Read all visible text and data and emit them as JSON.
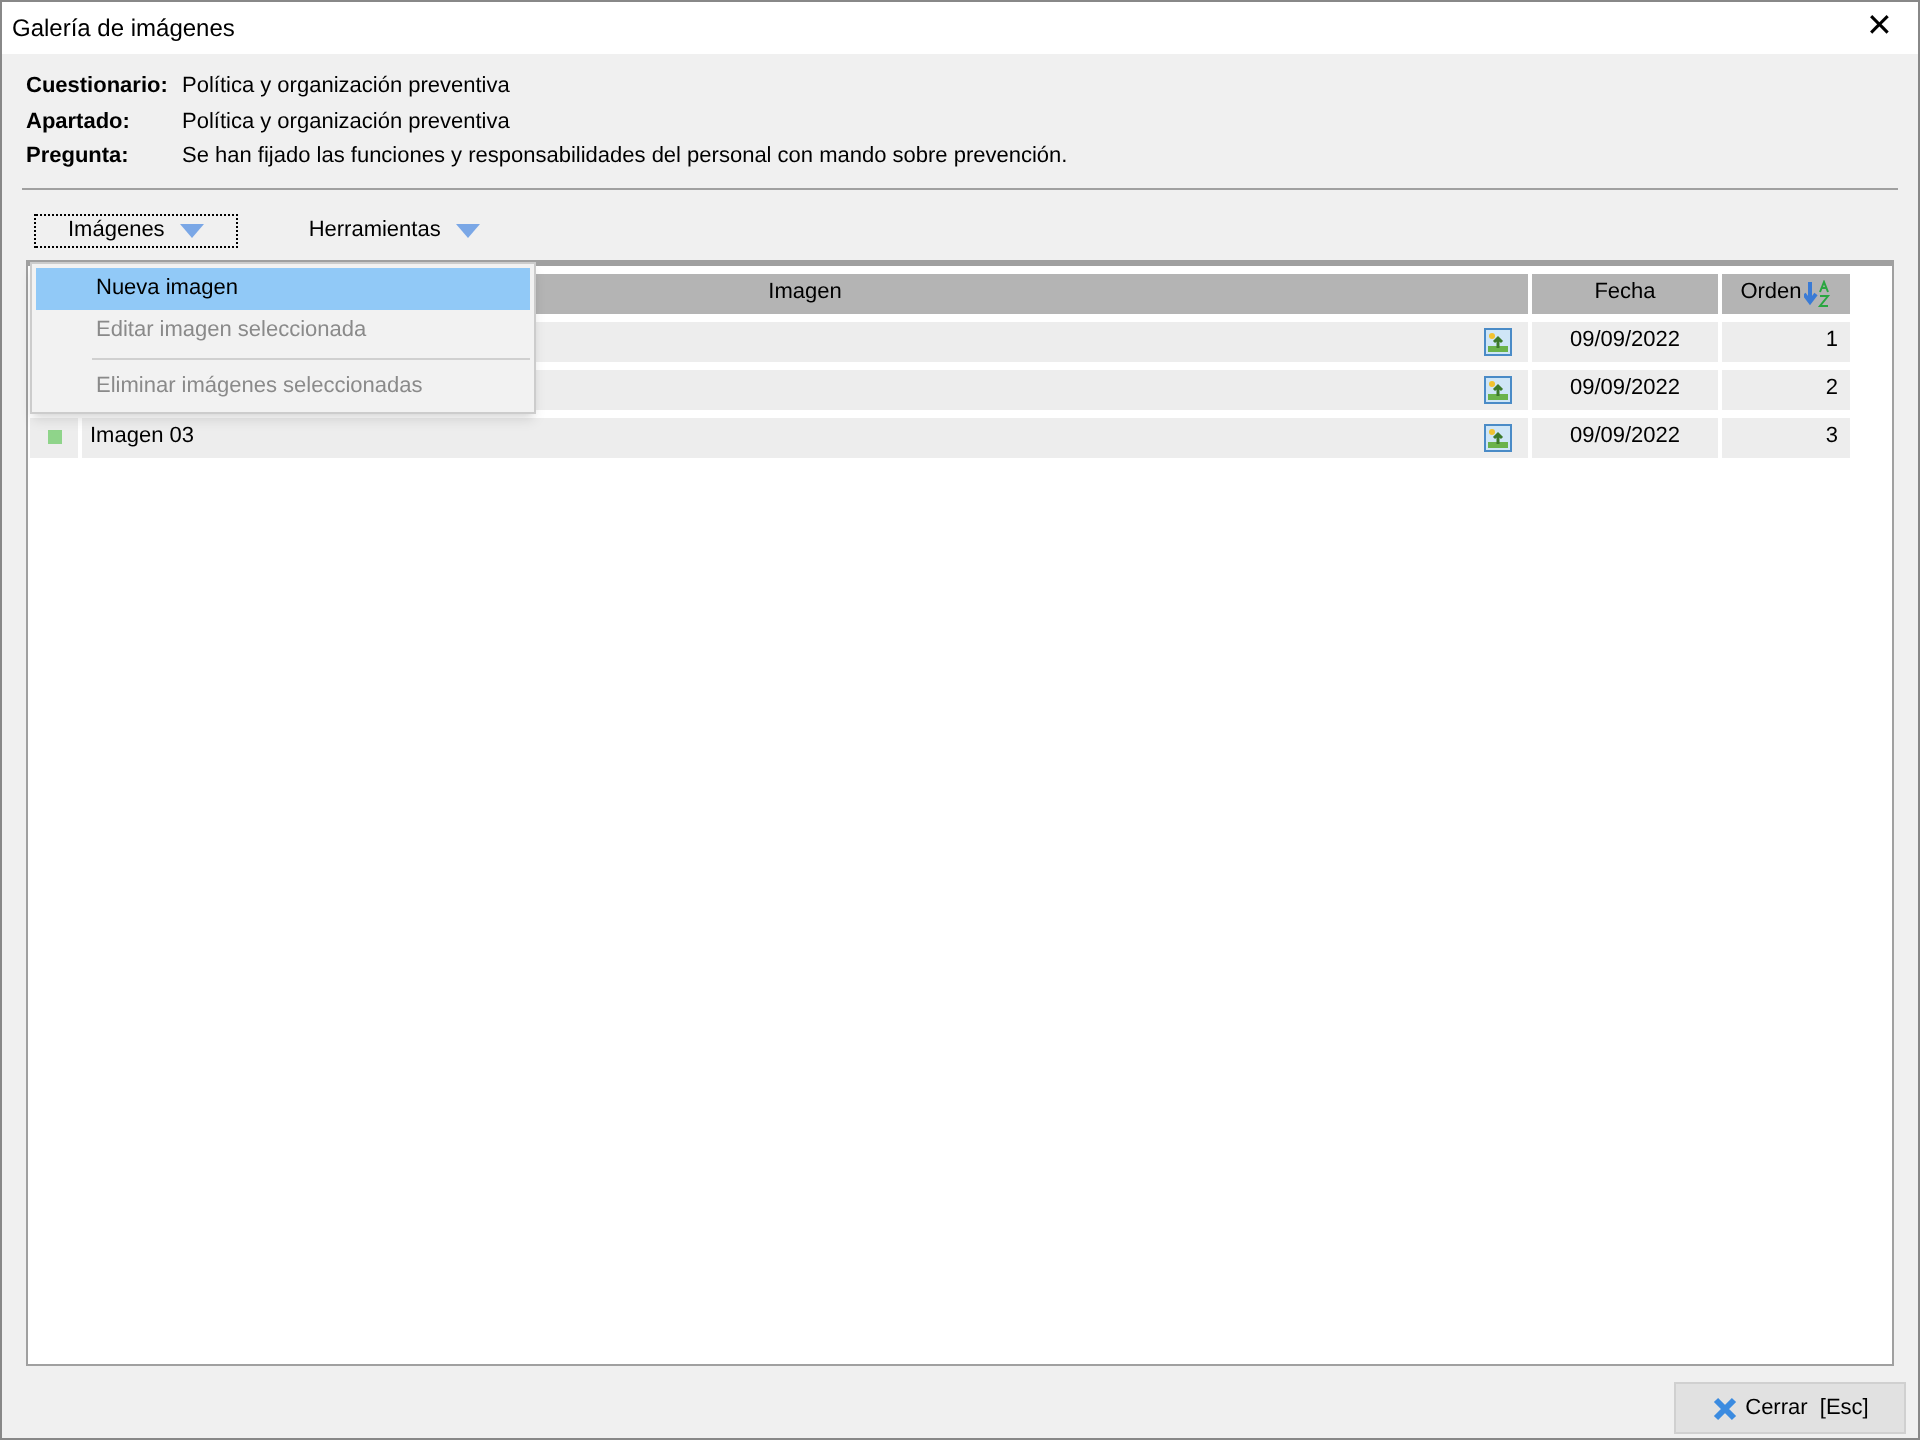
{
  "window": {
    "title": "Galería de imágenes",
    "close": "✕"
  },
  "info": [
    {
      "label": "Cuestionario:",
      "value": "Política y organización preventiva"
    },
    {
      "label": "Apartado:",
      "value": "Política y organización preventiva"
    },
    {
      "label": "Pregunta:",
      "value": "Se han fijado las funciones y responsabilidades del personal con mando sobre prevención."
    }
  ],
  "toolbar": [
    {
      "label": "Imágenes",
      "selected": true
    },
    {
      "label": "Herramientas",
      "selected": false
    }
  ],
  "menu": [
    {
      "kind": "item",
      "label": "Nueva imagen",
      "selected": true,
      "disabled": false
    },
    {
      "kind": "item",
      "label": "Editar imagen seleccionada",
      "selected": false,
      "disabled": true
    },
    {
      "kind": "separator"
    },
    {
      "kind": "item",
      "label": "Eliminar imágenes seleccionadas",
      "selected": false,
      "disabled": true
    }
  ],
  "table": {
    "columns": [
      "Imagen",
      "Fecha",
      "Orden"
    ],
    "rows": [
      {
        "date": "09/09/2022",
        "order": "1"
      },
      {
        "date": "09/09/2022",
        "order": "2"
      },
      {
        "name": "Imagen 03",
        "date": "09/09/2022",
        "order": "3",
        "color": "#8fd48a"
      }
    ]
  },
  "footer": {
    "button": "Cerrar  [Esc]"
  }
}
